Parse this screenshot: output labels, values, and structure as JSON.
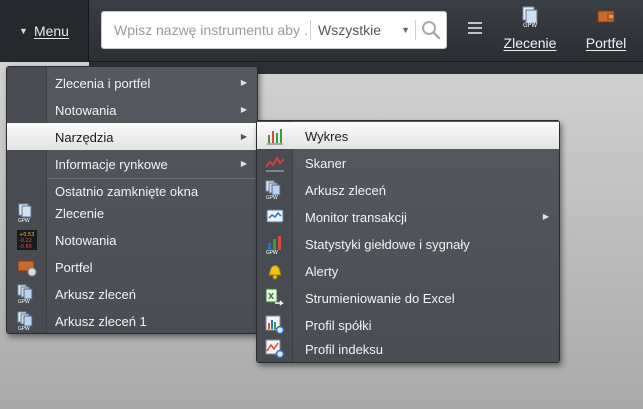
{
  "topbar": {
    "menu_label": "Menu",
    "search_placeholder": "Wpisz nazwę instrumentu aby ...",
    "search_filter": "Wszystkie",
    "tools": [
      {
        "label": "Zlecenie",
        "icon": "order-document-icon"
      },
      {
        "label": "Portfel",
        "icon": "wallet-icon"
      }
    ]
  },
  "main_menu": {
    "items": [
      {
        "label": "Zlecenia i portfel",
        "has_submenu": true
      },
      {
        "label": "Notowania",
        "has_submenu": true
      },
      {
        "label": "Narzędzia",
        "has_submenu": true,
        "active": true
      },
      {
        "label": "Informacje rynkowe",
        "has_submenu": true
      }
    ],
    "recent_heading": "Ostatnio zamknięte okna",
    "recent": [
      {
        "label": "Zlecenie",
        "icon": "order-document-icon"
      },
      {
        "label": "Notowania",
        "icon": "quotes-icon"
      },
      {
        "label": "Portfel",
        "icon": "wallet-icon"
      },
      {
        "label": "Arkusz zleceń",
        "icon": "order-sheet-icon"
      },
      {
        "label": "Arkusz zleceń 1",
        "icon": "order-sheet-icon"
      }
    ]
  },
  "sub_menu": {
    "items": [
      {
        "label": "Wykres",
        "icon": "bar-chart-icon",
        "active": true
      },
      {
        "label": "Skaner",
        "icon": "scanner-icon"
      },
      {
        "label": "Arkusz zleceń",
        "icon": "order-sheet-icon"
      },
      {
        "label": "Monitor transakcji",
        "icon": "monitor-icon",
        "has_submenu": true
      },
      {
        "label": "Statystyki giełdowe i sygnały",
        "icon": "statistics-icon"
      },
      {
        "label": "Alerty",
        "icon": "alert-bell-icon"
      },
      {
        "label": "Strumieniowanie do Excel",
        "icon": "excel-stream-icon"
      },
      {
        "label": "Profil spółki",
        "icon": "company-profile-icon"
      },
      {
        "label": "Profil indeksu",
        "icon": "index-profile-icon"
      }
    ]
  },
  "colors": {
    "topbar": "#2b2e33",
    "menu_bg": "#4f5359",
    "active_bg": "#f2f2f2",
    "text": "#f2f2f2"
  }
}
